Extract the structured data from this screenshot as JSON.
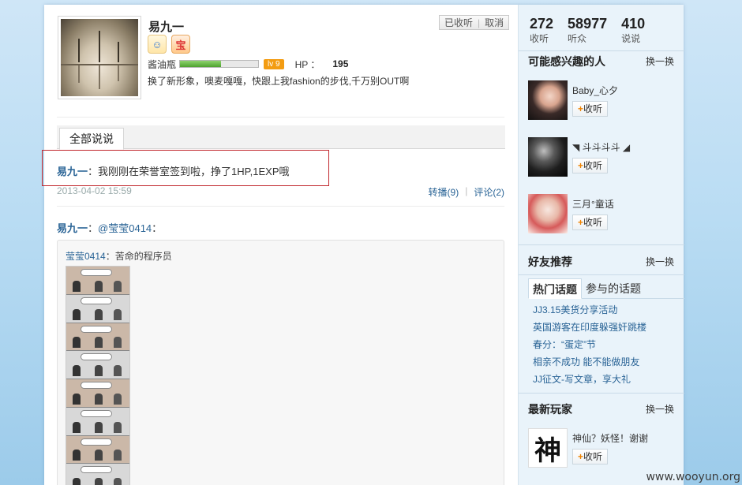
{
  "profile": {
    "username": "易九一",
    "level_name": "酱油瓶",
    "exp_progress": 0.53,
    "level_tag": "lv 9",
    "hp_label": "HP ：",
    "hp_value": "195",
    "signature": "换了新形象，噢麦嘎嘎，快跟上我fashion的步伐,千万别OUT啊",
    "badges": [
      "user-badge-icon",
      "treasure-badge-icon"
    ],
    "follow_status": "已收听",
    "unfollow": "取消"
  },
  "tabs": {
    "active": "全部说说"
  },
  "posts": [
    {
      "author": "易九一",
      "colon": "：",
      "content": "我刚刚在荣誉室签到啦，挣了1HP,1EXP哦",
      "time": "2013-04-02 15:59",
      "forward": "转播(9)",
      "comment": "评论(2)",
      "highlighted": true
    },
    {
      "author": "易九一",
      "colon": "：",
      "mention": "@莹莹0414",
      "trail": "：",
      "quote_author": "莹莹0414",
      "quote_text": "苦命的程序员"
    }
  ],
  "sidebar": {
    "stats": [
      {
        "num": "272",
        "label": "收听"
      },
      {
        "num": "58977",
        "label": "听众"
      },
      {
        "num": "410",
        "label": "说说"
      }
    ],
    "interest_title": "可能感兴趣的人",
    "refresh": "换一换",
    "suggestions": [
      {
        "name": "Baby_心夕",
        "follow": "收听"
      },
      {
        "name": "◥ 斗斗斗斗 ◢",
        "follow": "收听"
      },
      {
        "name": "三月°童话",
        "follow": "收听"
      }
    ],
    "friends_title": "好友推荐",
    "topic_tabs": [
      "热门话题",
      "参与的话题"
    ],
    "topics": [
      "JJ3.15美货分享活动",
      "英国游客在印度躲强奸跳楼",
      "春分：“蛋定”节",
      "相亲不成功 能不能做朋友",
      "JJ征文-写文章，享大礼"
    ],
    "new_players_title": "最新玩家",
    "new_player": {
      "name": "神仙？妖怪！谢谢",
      "follow": "收听"
    }
  },
  "watermark": "www.wooyun.org",
  "colors": {
    "link": "#2a6496",
    "highlight_border": "#c1272d",
    "level_tag": "#f39c12",
    "exp_fill": "#4ea22f"
  }
}
